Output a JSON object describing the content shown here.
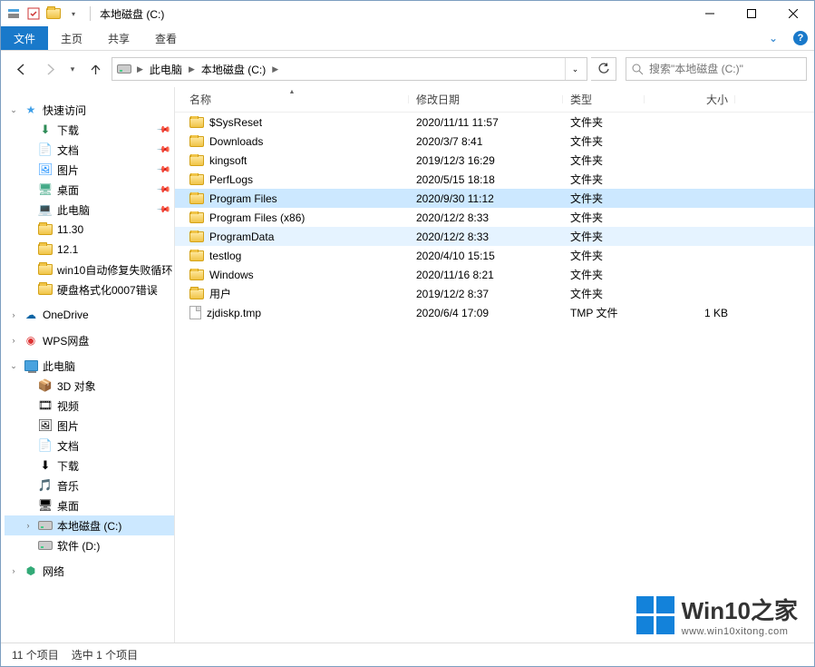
{
  "window": {
    "title": "本地磁盘 (C:)"
  },
  "ribbon": {
    "file": "文件",
    "tabs": [
      "主页",
      "共享",
      "查看"
    ]
  },
  "breadcrumbs": {
    "root": "此电脑",
    "current": "本地磁盘 (C:)"
  },
  "search": {
    "placeholder": "搜索\"本地磁盘 (C:)\""
  },
  "sidebar": {
    "quick_access": "快速访问",
    "quick_items": [
      {
        "label": "下载",
        "pinned": true
      },
      {
        "label": "文档",
        "pinned": true
      },
      {
        "label": "图片",
        "pinned": true
      },
      {
        "label": "桌面",
        "pinned": true
      },
      {
        "label": "此电脑",
        "pinned": true
      },
      {
        "label": "11.30",
        "pinned": false
      },
      {
        "label": "12.1",
        "pinned": false
      },
      {
        "label": "win10自动修复失败循环",
        "pinned": false
      },
      {
        "label": "硬盘格式化0007错误",
        "pinned": false
      }
    ],
    "onedrive": "OneDrive",
    "wps": "WPS网盘",
    "thispc": "此电脑",
    "pc_items": [
      "3D 对象",
      "视频",
      "图片",
      "文档",
      "下载",
      "音乐",
      "桌面",
      "本地磁盘 (C:)",
      "软件 (D:)"
    ],
    "network": "网络"
  },
  "columns": {
    "name": "名称",
    "date": "修改日期",
    "type": "类型",
    "size": "大小"
  },
  "files": [
    {
      "name": "$SysReset",
      "date": "2020/11/11 11:57",
      "type": "文件夹",
      "size": "",
      "kind": "folder"
    },
    {
      "name": "Downloads",
      "date": "2020/3/7 8:41",
      "type": "文件夹",
      "size": "",
      "kind": "folder"
    },
    {
      "name": "kingsoft",
      "date": "2019/12/3 16:29",
      "type": "文件夹",
      "size": "",
      "kind": "folder"
    },
    {
      "name": "PerfLogs",
      "date": "2020/5/15 18:18",
      "type": "文件夹",
      "size": "",
      "kind": "folder"
    },
    {
      "name": "Program Files",
      "date": "2020/9/30 11:12",
      "type": "文件夹",
      "size": "",
      "kind": "folder",
      "selected": true
    },
    {
      "name": "Program Files (x86)",
      "date": "2020/12/2 8:33",
      "type": "文件夹",
      "size": "",
      "kind": "folder"
    },
    {
      "name": "ProgramData",
      "date": "2020/12/2 8:33",
      "type": "文件夹",
      "size": "",
      "kind": "folder",
      "hover": true
    },
    {
      "name": "testlog",
      "date": "2020/4/10 15:15",
      "type": "文件夹",
      "size": "",
      "kind": "folder"
    },
    {
      "name": "Windows",
      "date": "2020/11/16 8:21",
      "type": "文件夹",
      "size": "",
      "kind": "folder"
    },
    {
      "name": "用户",
      "date": "2019/12/2 8:37",
      "type": "文件夹",
      "size": "",
      "kind": "folder"
    },
    {
      "name": "zjdiskp.tmp",
      "date": "2020/6/4 17:09",
      "type": "TMP 文件",
      "size": "1 KB",
      "kind": "file"
    }
  ],
  "status": {
    "count": "11 个项目",
    "selection": "选中 1 个项目"
  },
  "watermark": {
    "title": "Win10之家",
    "url": "www.win10xitong.com"
  }
}
